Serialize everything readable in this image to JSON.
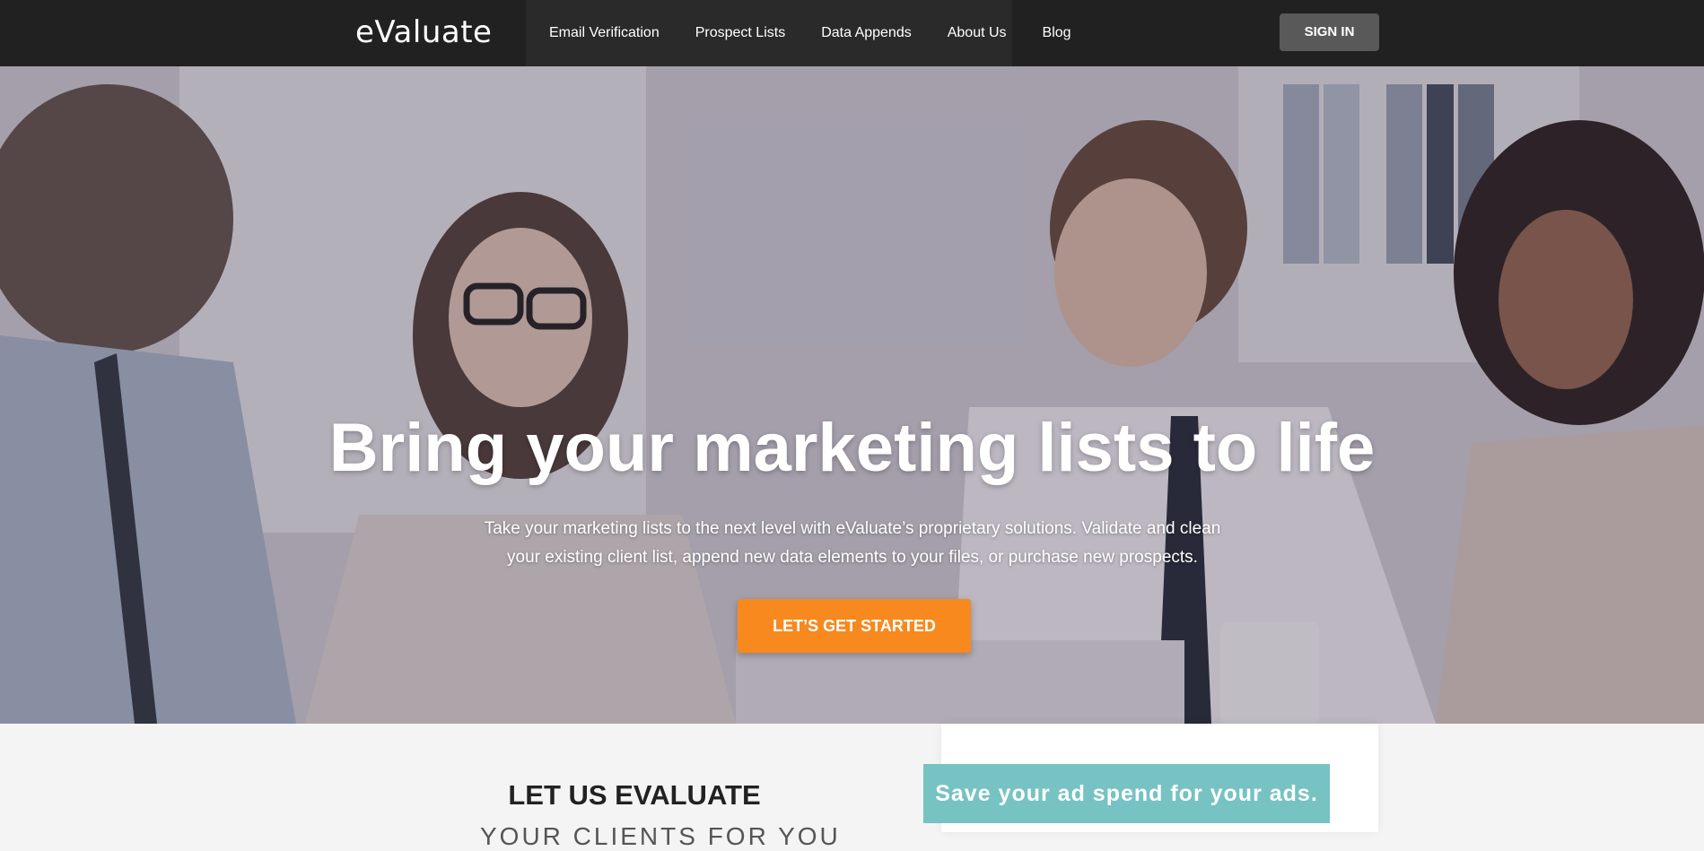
{
  "brand": {
    "logo_text": "eValuate",
    "accent": "#f7941d"
  },
  "nav": {
    "links": [
      "Email Verification",
      "Prospect Lists",
      "Data Appends",
      "About Us",
      "Blog"
    ],
    "signin_label": "SIGN IN"
  },
  "hero": {
    "title": "Bring your marketing lists to life",
    "subtitle_line1": "Take your marketing lists to the next level with eValuate’s proprietary solutions. Validate and clean",
    "subtitle_line2": "your existing client list, append new data elements to your files, or purchase new prospects.",
    "cta_label": "LET’S GET STARTED",
    "cta_color": "#f7891f"
  },
  "section": {
    "title": "LET US EVALUATE",
    "subtitle": "YOUR CLIENTS FOR YOU",
    "promo_text": "Save your ad spend for your ads.",
    "promo_color": "#77c2c3"
  }
}
